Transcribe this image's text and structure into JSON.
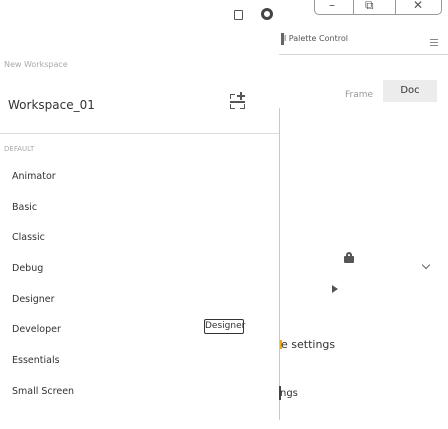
{
  "app": {
    "window_controls": [
      "–",
      "⧉",
      "✕"
    ],
    "palette_label": "l Palette Control",
    "tabs": {
      "frame": "Frame",
      "doc": "Doc"
    },
    "settings_text": "e settings",
    "ings_text": "ngs"
  },
  "workspace_panel": {
    "title": "New Workspace",
    "current": "Workspace_01",
    "section": "DEFAULT",
    "items": [
      {
        "label": "Animator"
      },
      {
        "label": "Basic"
      },
      {
        "label": "Classic"
      },
      {
        "label": "Debug"
      },
      {
        "label": "Designer"
      },
      {
        "label": "Developer"
      },
      {
        "label": "Essentials"
      },
      {
        "label": "Small Screen"
      }
    ],
    "badge": "Designer"
  }
}
